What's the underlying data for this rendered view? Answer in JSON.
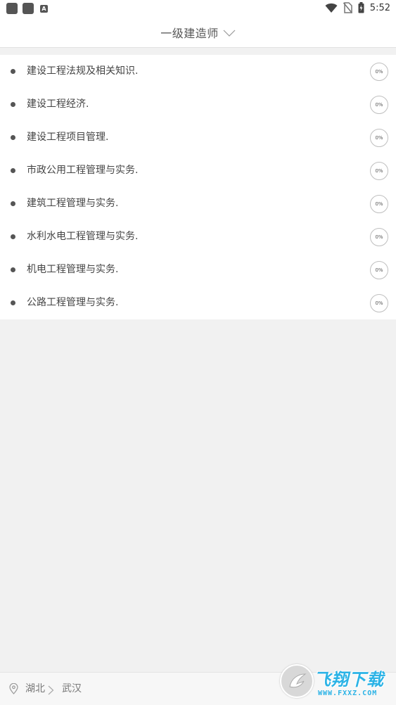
{
  "status_bar": {
    "time": "5:52",
    "notification_letter": "A",
    "icons": [
      "notification-square-icon",
      "notification-square-icon",
      "notification-a-icon",
      "wifi-icon",
      "no-sim-icon",
      "battery-charging-icon"
    ]
  },
  "header": {
    "title": "一级建造师",
    "dropdown_icon": "chevron-down-icon"
  },
  "subjects": [
    {
      "label": "建设工程法规及相关知识.",
      "progress": "0%"
    },
    {
      "label": "建设工程经济.",
      "progress": "0%"
    },
    {
      "label": "建设工程项目管理.",
      "progress": "0%"
    },
    {
      "label": "市政公用工程管理与实务.",
      "progress": "0%"
    },
    {
      "label": "建筑工程管理与实务.",
      "progress": "0%"
    },
    {
      "label": "水利水电工程管理与实务.",
      "progress": "0%"
    },
    {
      "label": "机电工程管理与实务.",
      "progress": "0%"
    },
    {
      "label": "公路工程管理与实务.",
      "progress": "0%"
    }
  ],
  "location": {
    "province": "湖北",
    "city": "武汉",
    "pin_icon": "location-pin-icon",
    "separator_icon": "chevron-right-icon"
  },
  "watermark": {
    "title": "飞翔下载",
    "url": "WWW.FXXZ.COM"
  },
  "colors": {
    "background": "#f1f1f1",
    "card": "#ffffff",
    "text": "#444444",
    "watermark": "#2bb3e6"
  }
}
